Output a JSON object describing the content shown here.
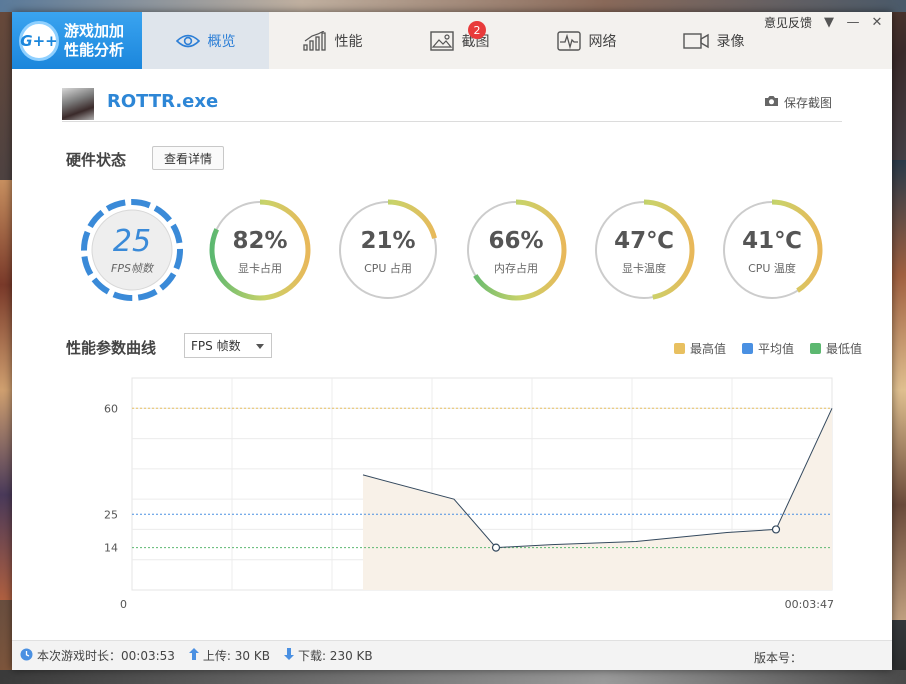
{
  "app": {
    "logo_mark": "G++",
    "logo_line1": "游戏加加",
    "logo_line2": "性能分析"
  },
  "nav": {
    "tabs": [
      {
        "label": "概览",
        "icon": "eye-icon",
        "active": true
      },
      {
        "label": "性能",
        "icon": "bar-chart-icon",
        "active": false
      },
      {
        "label": "截图",
        "icon": "image-icon",
        "active": false,
        "badge": "2"
      },
      {
        "label": "网络",
        "icon": "pulse-icon",
        "active": false
      },
      {
        "label": "录像",
        "icon": "video-icon",
        "active": false
      }
    ]
  },
  "window_controls": {
    "feedback": "意见反馈",
    "dropdown": "▼",
    "minimize": "—",
    "close": "✕"
  },
  "game": {
    "name": "ROTTR.exe",
    "save_screenshot": "保存截图"
  },
  "hardware": {
    "title": "硬件状态",
    "details_button": "查看详情",
    "fps": {
      "value": "25",
      "label": "FPS帧数"
    },
    "gauges": [
      {
        "value_text": "82%",
        "label": "显卡占用",
        "fraction": 0.82
      },
      {
        "value_text": "21%",
        "label": "CPU 占用",
        "fraction": 0.21
      },
      {
        "value_text": "66%",
        "label": "内存占用",
        "fraction": 0.66
      },
      {
        "value_text": "47℃",
        "label": "显卡温度",
        "fraction": 0.47
      },
      {
        "value_text": "41℃",
        "label": "CPU 温度",
        "fraction": 0.41
      }
    ],
    "colors": {
      "low": "#5cb870",
      "mid": "#c9d36a",
      "high": "#e8b85a",
      "track": "#cccccc",
      "fps": "#3a8ad8"
    }
  },
  "performance": {
    "title": "性能参数曲线",
    "metric_selected": "FPS 帧数",
    "legend": [
      {
        "label": "最高值",
        "color": "#e8c060"
      },
      {
        "label": "平均值",
        "color": "#4a90e2"
      },
      {
        "label": "最低值",
        "color": "#5cb870"
      }
    ]
  },
  "chart_data": {
    "type": "area",
    "x_start_label": "0",
    "x_end_label": "00:03:47",
    "ylim": [
      0,
      70
    ],
    "yticks": [
      14,
      25,
      60
    ],
    "reference_lines": {
      "max": 60,
      "avg": 25,
      "min": 14
    },
    "series": [
      {
        "x_fraction": [
          0.33,
          0.46,
          0.52,
          0.6,
          0.72,
          0.85,
          0.92,
          1.0
        ],
        "values": [
          38,
          30,
          14,
          15,
          16,
          19,
          20,
          60
        ],
        "markers_at": [
          2,
          6
        ]
      }
    ],
    "colors": {
      "line": "#34495e",
      "fill": "#f8f1e8",
      "max": "#e8c060",
      "avg": "#4a90e2",
      "min": "#5cb870"
    }
  },
  "status": {
    "play_time_label": "本次游戏时长：00:03:53",
    "upload_label": "上传: 30 KB",
    "download_label": "下载: 230 KB",
    "version_label": "版本号："
  }
}
